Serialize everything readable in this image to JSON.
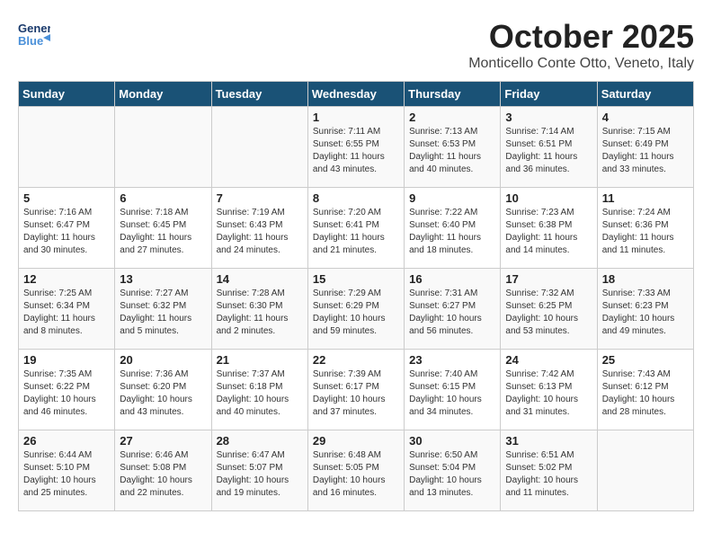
{
  "header": {
    "logo_line1": "General",
    "logo_line2": "Blue",
    "month_year": "October 2025",
    "location": "Monticello Conte Otto, Veneto, Italy"
  },
  "days_of_week": [
    "Sunday",
    "Monday",
    "Tuesday",
    "Wednesday",
    "Thursday",
    "Friday",
    "Saturday"
  ],
  "weeks": [
    [
      {
        "day": "",
        "info": ""
      },
      {
        "day": "",
        "info": ""
      },
      {
        "day": "",
        "info": ""
      },
      {
        "day": "1",
        "info": "Sunrise: 7:11 AM\nSunset: 6:55 PM\nDaylight: 11 hours and 43 minutes."
      },
      {
        "day": "2",
        "info": "Sunrise: 7:13 AM\nSunset: 6:53 PM\nDaylight: 11 hours and 40 minutes."
      },
      {
        "day": "3",
        "info": "Sunrise: 7:14 AM\nSunset: 6:51 PM\nDaylight: 11 hours and 36 minutes."
      },
      {
        "day": "4",
        "info": "Sunrise: 7:15 AM\nSunset: 6:49 PM\nDaylight: 11 hours and 33 minutes."
      }
    ],
    [
      {
        "day": "5",
        "info": "Sunrise: 7:16 AM\nSunset: 6:47 PM\nDaylight: 11 hours and 30 minutes."
      },
      {
        "day": "6",
        "info": "Sunrise: 7:18 AM\nSunset: 6:45 PM\nDaylight: 11 hours and 27 minutes."
      },
      {
        "day": "7",
        "info": "Sunrise: 7:19 AM\nSunset: 6:43 PM\nDaylight: 11 hours and 24 minutes."
      },
      {
        "day": "8",
        "info": "Sunrise: 7:20 AM\nSunset: 6:41 PM\nDaylight: 11 hours and 21 minutes."
      },
      {
        "day": "9",
        "info": "Sunrise: 7:22 AM\nSunset: 6:40 PM\nDaylight: 11 hours and 18 minutes."
      },
      {
        "day": "10",
        "info": "Sunrise: 7:23 AM\nSunset: 6:38 PM\nDaylight: 11 hours and 14 minutes."
      },
      {
        "day": "11",
        "info": "Sunrise: 7:24 AM\nSunset: 6:36 PM\nDaylight: 11 hours and 11 minutes."
      }
    ],
    [
      {
        "day": "12",
        "info": "Sunrise: 7:25 AM\nSunset: 6:34 PM\nDaylight: 11 hours and 8 minutes."
      },
      {
        "day": "13",
        "info": "Sunrise: 7:27 AM\nSunset: 6:32 PM\nDaylight: 11 hours and 5 minutes."
      },
      {
        "day": "14",
        "info": "Sunrise: 7:28 AM\nSunset: 6:30 PM\nDaylight: 11 hours and 2 minutes."
      },
      {
        "day": "15",
        "info": "Sunrise: 7:29 AM\nSunset: 6:29 PM\nDaylight: 10 hours and 59 minutes."
      },
      {
        "day": "16",
        "info": "Sunrise: 7:31 AM\nSunset: 6:27 PM\nDaylight: 10 hours and 56 minutes."
      },
      {
        "day": "17",
        "info": "Sunrise: 7:32 AM\nSunset: 6:25 PM\nDaylight: 10 hours and 53 minutes."
      },
      {
        "day": "18",
        "info": "Sunrise: 7:33 AM\nSunset: 6:23 PM\nDaylight: 10 hours and 49 minutes."
      }
    ],
    [
      {
        "day": "19",
        "info": "Sunrise: 7:35 AM\nSunset: 6:22 PM\nDaylight: 10 hours and 46 minutes."
      },
      {
        "day": "20",
        "info": "Sunrise: 7:36 AM\nSunset: 6:20 PM\nDaylight: 10 hours and 43 minutes."
      },
      {
        "day": "21",
        "info": "Sunrise: 7:37 AM\nSunset: 6:18 PM\nDaylight: 10 hours and 40 minutes."
      },
      {
        "day": "22",
        "info": "Sunrise: 7:39 AM\nSunset: 6:17 PM\nDaylight: 10 hours and 37 minutes."
      },
      {
        "day": "23",
        "info": "Sunrise: 7:40 AM\nSunset: 6:15 PM\nDaylight: 10 hours and 34 minutes."
      },
      {
        "day": "24",
        "info": "Sunrise: 7:42 AM\nSunset: 6:13 PM\nDaylight: 10 hours and 31 minutes."
      },
      {
        "day": "25",
        "info": "Sunrise: 7:43 AM\nSunset: 6:12 PM\nDaylight: 10 hours and 28 minutes."
      }
    ],
    [
      {
        "day": "26",
        "info": "Sunrise: 6:44 AM\nSunset: 5:10 PM\nDaylight: 10 hours and 25 minutes."
      },
      {
        "day": "27",
        "info": "Sunrise: 6:46 AM\nSunset: 5:08 PM\nDaylight: 10 hours and 22 minutes."
      },
      {
        "day": "28",
        "info": "Sunrise: 6:47 AM\nSunset: 5:07 PM\nDaylight: 10 hours and 19 minutes."
      },
      {
        "day": "29",
        "info": "Sunrise: 6:48 AM\nSunset: 5:05 PM\nDaylight: 10 hours and 16 minutes."
      },
      {
        "day": "30",
        "info": "Sunrise: 6:50 AM\nSunset: 5:04 PM\nDaylight: 10 hours and 13 minutes."
      },
      {
        "day": "31",
        "info": "Sunrise: 6:51 AM\nSunset: 5:02 PM\nDaylight: 10 hours and 11 minutes."
      },
      {
        "day": "",
        "info": ""
      }
    ]
  ]
}
